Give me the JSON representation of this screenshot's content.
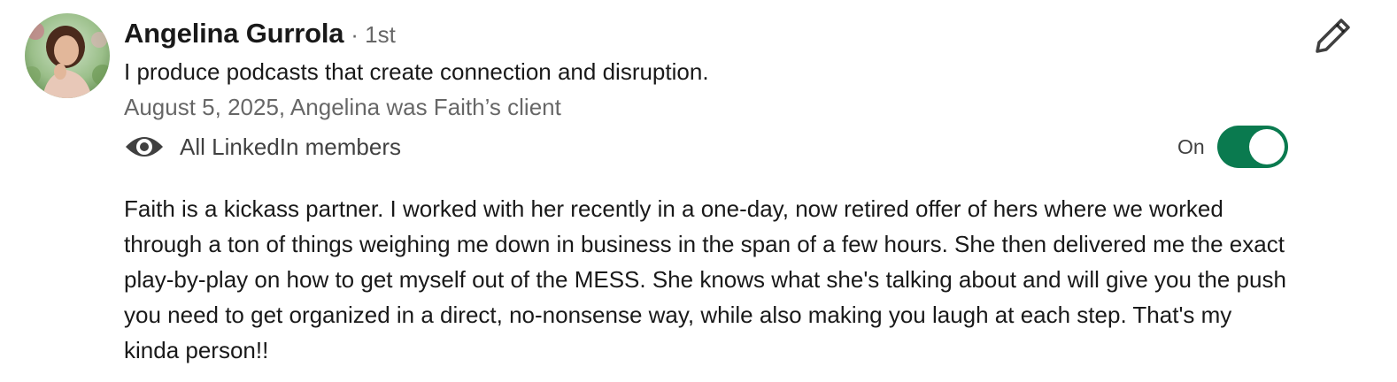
{
  "recommendation": {
    "recommender": {
      "name": "Angelina Gurrola",
      "connection_degree": "· 1st",
      "headline": "I produce podcasts that create connection and disruption."
    },
    "meta": "August 5, 2025, Angelina was Faith’s client",
    "visibility": {
      "icon": "eye-icon",
      "label": "All LinkedIn members"
    },
    "toggle": {
      "state_label": "On",
      "is_on": true
    },
    "text": "Faith is a kickass partner. I worked with her recently in a one-day, now retired offer of hers where we worked through a ton of things weighing me down in business in the span of a few hours. She then delivered me the exact play-by-play on how to get myself out of the MESS. She knows what she's talking about and will give you the push you need to get organized in a direct, no-nonsense way, while also making you laugh at each step. That's my kinda person!!",
    "edit_icon": "pencil-icon"
  },
  "colors": {
    "toggle_on": "#0a7a4f",
    "text_primary": "#1f1f1f",
    "text_secondary": "#666666"
  }
}
